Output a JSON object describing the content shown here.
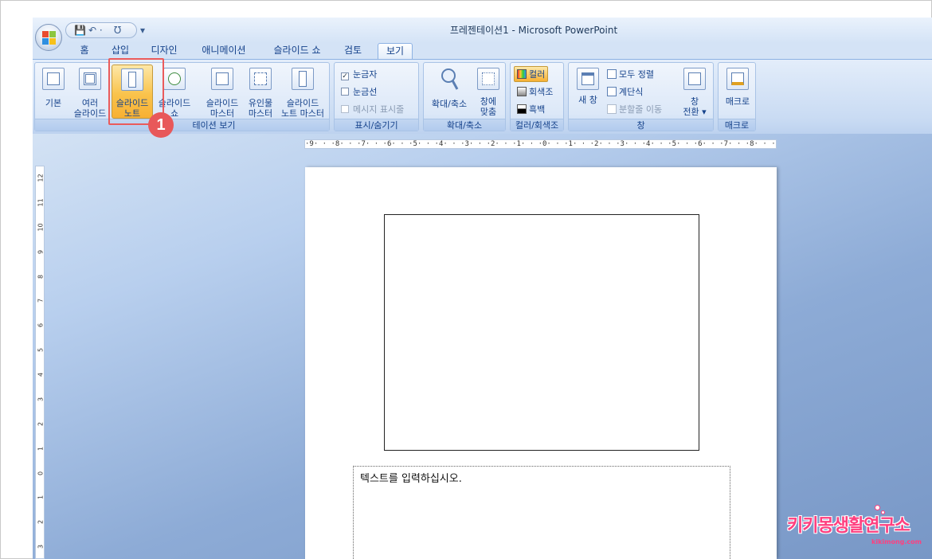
{
  "window": {
    "title": "프레젠테이션1 - Microsoft PowerPoint"
  },
  "qat": {
    "save": "💾",
    "undo": "↶ ·",
    "redo": "Ʊ",
    "more": "▾"
  },
  "tabs": [
    {
      "label": "홈"
    },
    {
      "label": "삽입"
    },
    {
      "label": "디자인"
    },
    {
      "label": "애니메이션"
    },
    {
      "label": "슬라이드 쇼"
    },
    {
      "label": "검토"
    },
    {
      "label": "보기"
    }
  ],
  "active_tab": "보기",
  "groups": {
    "presentation_views": {
      "label": "프레젠테이션 보기",
      "label_visible": "테이션 보기",
      "buttons": {
        "normal": "기본",
        "sorter_1": "여러",
        "sorter_2": "슬라이드",
        "notes_1": "슬라이드",
        "notes_2": "노트",
        "show_1": "슬라이드",
        "show_2": "쇼",
        "slide_master_1": "슬라이드",
        "slide_master_2": "마스터",
        "handout_master_1": "유인물",
        "handout_master_2": "마스터",
        "notes_master_1": "슬라이드",
        "notes_master_2": "노트 마스터"
      }
    },
    "show_hide": {
      "label": "표시/숨기기",
      "ruler": "눈금자",
      "gridlines": "눈금선",
      "message_bar": "메시지 표시줄"
    },
    "zoom": {
      "label": "확대/축소",
      "zoom": "확대/축소",
      "fit_1": "창에",
      "fit_2": "맞춤"
    },
    "color": {
      "label": "컬러/회색조",
      "color": "컬러",
      "grayscale": "회색조",
      "bw": "흑백"
    },
    "window": {
      "label": "창",
      "new_window": "새 창",
      "arrange_all": "모두 정렬",
      "cascade": "계단식",
      "move_split": "분할줄 이동",
      "switch_1": "창",
      "switch_2": "전환 ▾"
    },
    "macros": {
      "label": "매크로",
      "macro": "매크로"
    }
  },
  "annotation": {
    "number": "1",
    "color": "#e8585a"
  },
  "ruler": {
    "horizontal": "·9· · ·8· · ·7· · ·6· · ·5· · ·4· · ·3· · ·2· · ·1· · ·0· · ·1· · ·2· · ·3· · ·4· · ·5· · ·6· · ·7· · ·8· · ·9·",
    "vertical_numbers": [
      "12",
      "11",
      "10",
      "9",
      "8",
      "7",
      "6",
      "5",
      "4",
      "3",
      "2",
      "1",
      "0",
      "1",
      "2",
      "3"
    ]
  },
  "notes": {
    "placeholder_text": "텍스트를 입력하십시오."
  },
  "watermark": {
    "main": "키키몽생활연구소",
    "sub": "kikimong.com"
  }
}
